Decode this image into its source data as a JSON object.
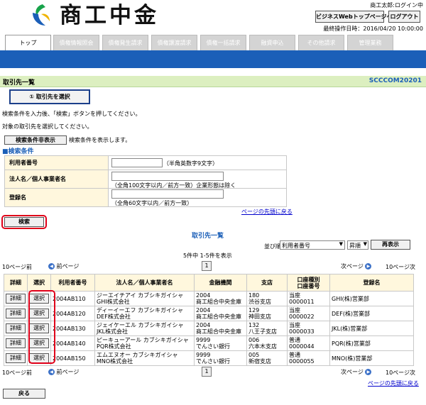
{
  "header": {
    "logo_text": "商工中金",
    "user": "商工太郎:ログイン中",
    "top_button": "ビジネスWebトップページへ",
    "logout_button": "ログアウト",
    "last_op": "最終操作日時：2016/04/20 10:00:00"
  },
  "tabs": [
    "トップ",
    "債権情報照会",
    "債権発生請求",
    "債権譲渡請求",
    "債権一括請求",
    "融資申込",
    "その他請求",
    "管理業務"
  ],
  "page": {
    "title": "取引先一覧",
    "code": "SCCCOM20201",
    "step_label": "① 取引先を選択",
    "instruction1": "検索条件を入力後、「検索」ボタンを押してください。",
    "instruction2": "対象の取引先を選択してください。",
    "toggle_button": "検索条件非表示",
    "toggle_note": "検索条件を表示します。",
    "search_section": "■検索条件"
  },
  "search": {
    "fields": [
      {
        "label": "利用者番号",
        "value": "",
        "hint": "（半角英数字9文字）"
      },
      {
        "label": "法人名／個人事業者名",
        "value": "",
        "hint": "（全角100文字以内／前方一致）企業形態は除く"
      },
      {
        "label": "登録名",
        "value": "",
        "hint": "（全角60文字以内／前方一致）"
      }
    ],
    "page_top_link": "ページの先頭に戻る",
    "search_button": "検索"
  },
  "results": {
    "title": "取引先一覧",
    "sort_label": "並び順:",
    "sort_value": "利用者番号",
    "order_value": "昇順",
    "redisplay_button": "再表示",
    "count_text": "5件中 1-5件を表示",
    "prev10": "10ページ前",
    "prev": "前ページ",
    "page_num": "1",
    "next": "次ページ",
    "next10": "10ページ次",
    "columns": [
      "詳細",
      "選択",
      "利用者番号",
      "法人名／個人事業者名",
      "金融機関",
      "支店",
      "口座種別",
      "口座番号",
      "登録名"
    ],
    "detail_label": "詳細",
    "select_label": "選択",
    "rows": [
      {
        "user_no": "2004AB110",
        "name_kana": "ジーエイチアイ カブシキガイシャ",
        "name": "GHI株式会社",
        "bank_code": "2004",
        "bank": "商工組合中央金庫",
        "branch_code": "180",
        "branch": "渋谷支店",
        "acct_type": "当座",
        "acct_no": "0000011",
        "reg_name": "GHI(株)営業部"
      },
      {
        "user_no": "2004AB120",
        "name_kana": "ディーイーエフ カブシキガイシャ",
        "name": "DEF株式会社",
        "bank_code": "2004",
        "bank": "商工組合中央金庫",
        "branch_code": "129",
        "branch": "神田支店",
        "acct_type": "当座",
        "acct_no": "0000022",
        "reg_name": "DEF(株)営業部"
      },
      {
        "user_no": "2004AB130",
        "name_kana": "ジェイケーエル カブシキガイシャ",
        "name": "JKL株式会社",
        "bank_code": "2004",
        "bank": "商工組合中央金庫",
        "branch_code": "132",
        "branch": "八王子支店",
        "acct_type": "当座",
        "acct_no": "0000033",
        "reg_name": "JKL(株)営業部"
      },
      {
        "user_no": "2004AB140",
        "name_kana": "ピーキューアール カブシキガイシャ",
        "name": "PQR株式会社",
        "bank_code": "9999",
        "bank": "でんさい銀行",
        "branch_code": "006",
        "branch": "六本木支店",
        "acct_type": "普通",
        "acct_no": "0000044",
        "reg_name": "PQR(株)営業部"
      },
      {
        "user_no": "2004AB150",
        "name_kana": "エムエヌオー カブシキガイシャ",
        "name": "MNO株式会社",
        "bank_code": "9999",
        "bank": "でんさい銀行",
        "branch_code": "005",
        "branch": "新宿支店",
        "acct_type": "普通",
        "acct_no": "0000055",
        "reg_name": "MNO(株)営業部"
      }
    ],
    "page_top_link": "ページの先頭に戻る"
  },
  "footer": {
    "back_button": "戻る"
  }
}
